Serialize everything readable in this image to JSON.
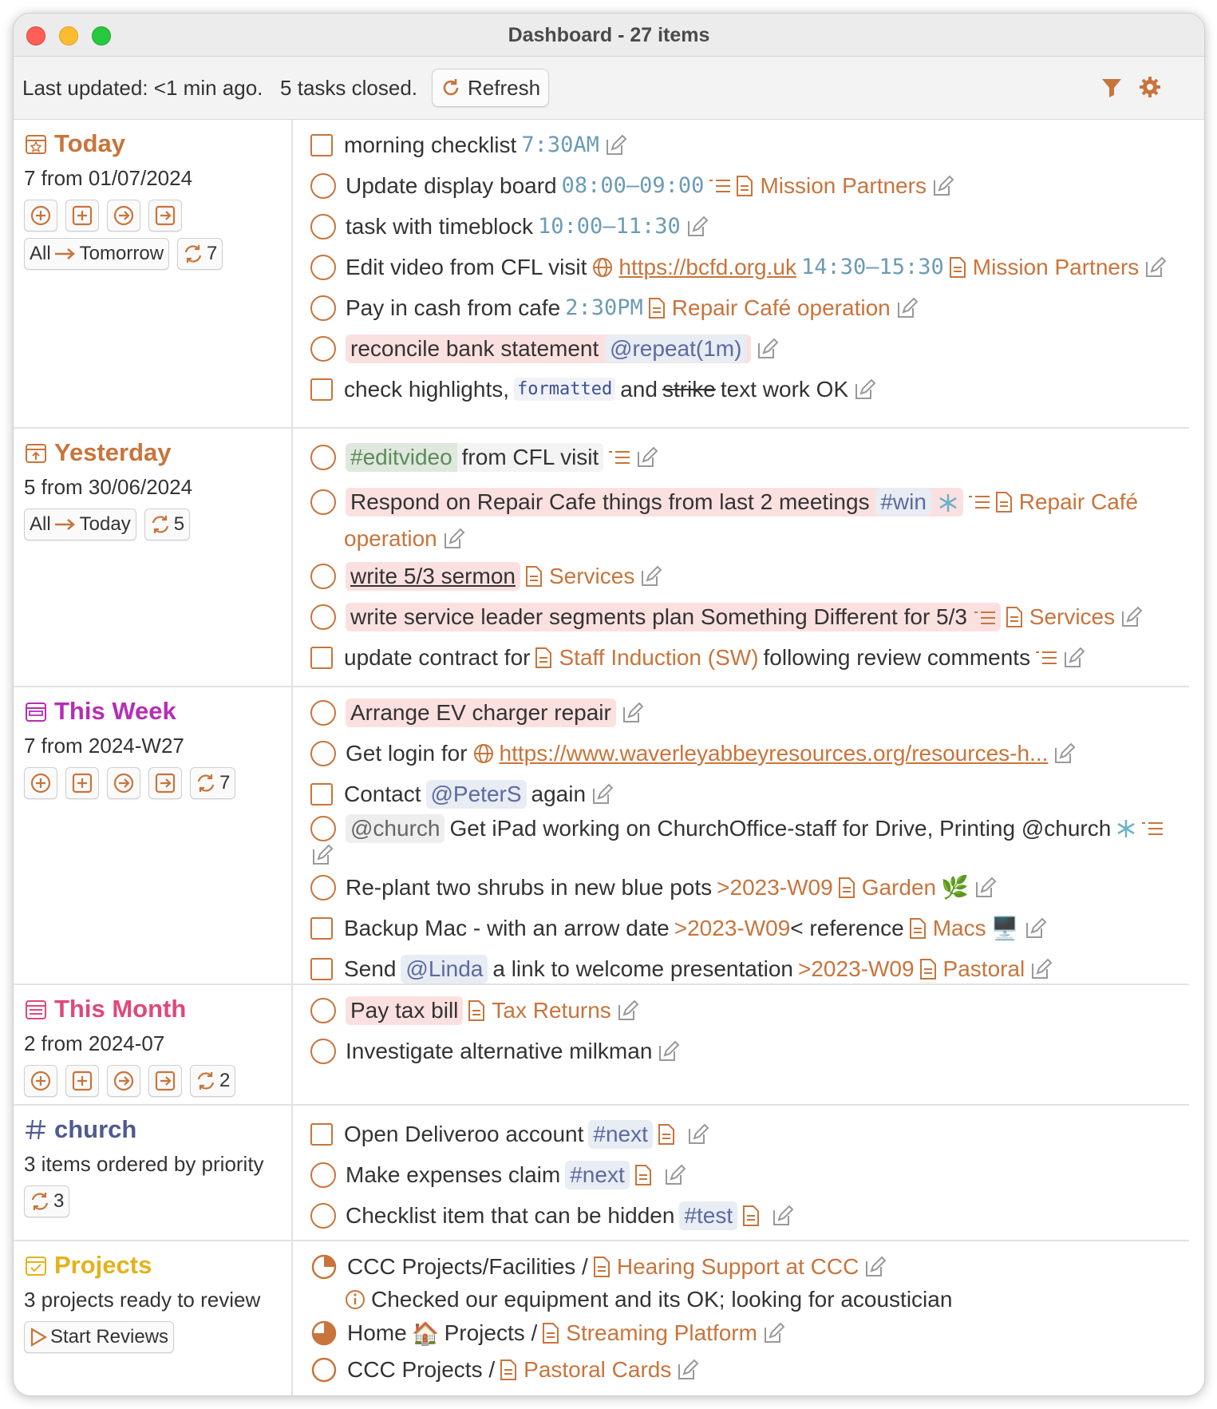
{
  "window": {
    "title": "Dashboard - 27 items"
  },
  "toolbar": {
    "status": "Last updated: <1 min ago.   5 tasks closed.",
    "refresh_label": "Refresh"
  },
  "sections": {
    "today": {
      "title": "Today",
      "subtitle": "7 from 01/07/2024",
      "move_label": "All",
      "move_target": "Tomorrow",
      "count": "7",
      "color": "#c8743b"
    },
    "yesterday": {
      "title": "Yesterday",
      "subtitle": "5 from 30/06/2024",
      "move_label": "All",
      "move_target": "Today",
      "count": "5",
      "color": "#c8743b"
    },
    "week": {
      "title": "This Week",
      "subtitle": "7 from 2024-W27",
      "count": "7",
      "color": "#b52eb5"
    },
    "month": {
      "title": "This Month",
      "subtitle": "2 from 2024-07",
      "count": "2",
      "color": "#e0477a"
    },
    "church": {
      "title": "church",
      "subtitle": "3 items ordered by priority",
      "count": "3",
      "color": "#4f5a8f"
    },
    "projects": {
      "title": "Projects",
      "subtitle": "3 projects ready to review",
      "button": "Start Reviews",
      "color": "#e3b21b"
    }
  },
  "today_items": {
    "i1": {
      "text": "morning checklist",
      "time": "7:30AM"
    },
    "i2": {
      "text": "Update display board",
      "time": "08:00–09:00",
      "note": "Mission Partners"
    },
    "i3": {
      "text": "task with timeblock",
      "time": "10:00–11:30"
    },
    "i4": {
      "text": "Edit video from CFL visit",
      "link": "https://bcfd.org.uk",
      "time": "14:30–15:30",
      "note": "Mission Partners"
    },
    "i5": {
      "text": "Pay in cash from cafe",
      "time": "2:30PM",
      "note": "Repair Café operation"
    },
    "i6": {
      "text": "reconcile bank statement",
      "tag": "@repeat(1m)"
    },
    "i7": {
      "a": "check highlights,",
      "code": "formatted",
      "b": "and",
      "strike": "strike",
      "c": "text work OK"
    }
  },
  "yesterday_items": {
    "i1": {
      "tag": "#editvideo",
      "text": "from CFL visit"
    },
    "i2": {
      "text": "Respond on Repair Cafe things from last 2 meetings",
      "tag": "#win",
      "note_a": "Repair Café",
      "note_b": "operation"
    },
    "i3": {
      "text": "write 5/3 sermon",
      "note": "Services"
    },
    "i4": {
      "text": "write service leader segments plan Something Different for 5/3",
      "note": "Services"
    },
    "i5": {
      "a": "update contract for",
      "note": "Staff Induction (SW)",
      "b": "following review comments"
    }
  },
  "week_items": {
    "i1": {
      "text": "Arrange EV charger repair"
    },
    "i2": {
      "text": "Get login for",
      "link": "https://www.waverleyabbeyresources.org/resources-h..."
    },
    "i3": {
      "a": "Contact",
      "tag": "@PeterS",
      "b": "again"
    },
    "i4": {
      "tag": "@church",
      "text": "Get iPad working on ChurchOffice-staff for Drive, Printing @church"
    },
    "i5": {
      "text": "Re-plant two shrubs in new blue pots",
      "date": ">2023-W09",
      "note": "Garden",
      "emoji": "🌿"
    },
    "i6": {
      "text": "Backup Mac - with an arrow date",
      "date": ">2023-W09",
      "after": "< reference",
      "note": "Macs",
      "emoji": "🖥️"
    },
    "i7": {
      "a": "Send",
      "tag": "@Linda",
      "b": "a link to welcome presentation",
      "date": ">2023-W09",
      "note": "Pastoral"
    }
  },
  "month_items": {
    "i1": {
      "text": "Pay tax bill",
      "note": "Tax Returns"
    },
    "i2": {
      "text": "Investigate alternative milkman"
    }
  },
  "church_items": {
    "i1": {
      "text": "Open Deliveroo account",
      "tag": "#next"
    },
    "i2": {
      "text": "Make expenses claim",
      "tag": "#next"
    },
    "i3": {
      "text": "Checklist item that can be hidden",
      "tag": "#test"
    }
  },
  "project_items": {
    "i1": {
      "path": "CCC Projects/Facilities /",
      "note": "Hearing Support at CCC",
      "progress": 0.25,
      "info": "Checked our equipment and its OK; looking for acoustician"
    },
    "i2": {
      "path_a": "Home",
      "emoji": "🏠",
      "path_b": "Projects /",
      "note": "Streaming Platform",
      "progress": 0.75
    },
    "i3": {
      "path": "CCC Projects /",
      "note": "Pastoral Cards",
      "progress": 0
    }
  }
}
